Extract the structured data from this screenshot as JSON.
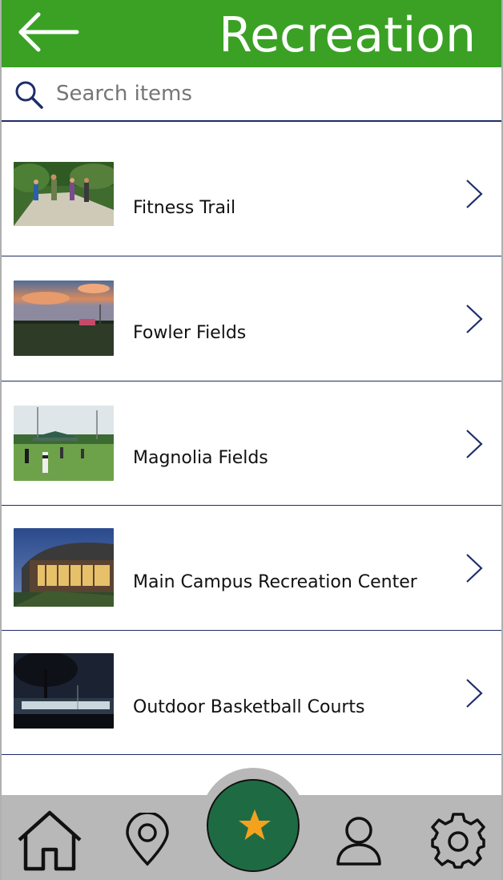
{
  "header": {
    "title": "Recreation",
    "back_icon": "arrow-left-icon",
    "background": "#3aa125"
  },
  "search": {
    "placeholder": "Search items",
    "value": "",
    "icon": "search-icon"
  },
  "list": {
    "items": [
      {
        "label": "Fitness Trail",
        "thumbnail": "runners-on-trail-photo"
      },
      {
        "label": "Fowler Fields",
        "thumbnail": "sunset-field-photo"
      },
      {
        "label": "Magnolia Fields",
        "thumbnail": "soccer-field-photo"
      },
      {
        "label": "Main Campus Recreation Center",
        "thumbnail": "recreation-building-photo"
      },
      {
        "label": "Outdoor Basketball Courts",
        "thumbnail": "night-courts-photo"
      }
    ],
    "divider_color": "#1f2d6b"
  },
  "bottom_nav": {
    "items": [
      {
        "icon": "home-icon"
      },
      {
        "icon": "map-pin-icon"
      },
      {
        "icon": "star-icon",
        "active": true
      },
      {
        "icon": "user-icon"
      },
      {
        "icon": "gear-icon"
      }
    ],
    "background": "#b8b8b8",
    "active_color": "#1e6b43",
    "star_color": "#f4a21d"
  }
}
